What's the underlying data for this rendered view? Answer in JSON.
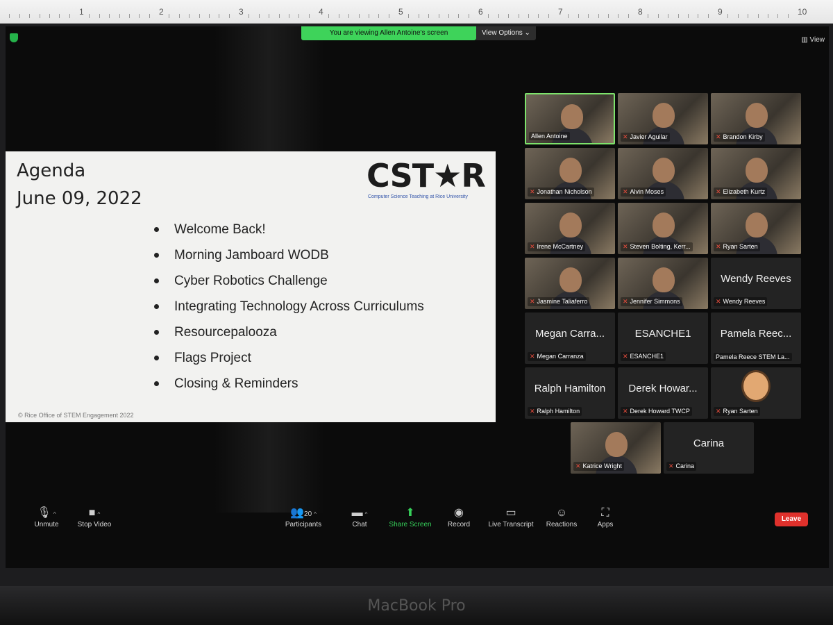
{
  "ruler": {
    "numbers": [
      "1",
      "2",
      "3",
      "4",
      "5",
      "6",
      "7",
      "8",
      "9",
      "10"
    ]
  },
  "zoom": {
    "banner": "You are viewing Allen Antoine's screen",
    "view_options": "View Options ⌄",
    "view_button": "View"
  },
  "slide": {
    "title": "Agenda",
    "date": "June 09, 2022",
    "logo": "CST★R",
    "logo_subtitle": "Computer Science Teaching at Rice University",
    "bullets": [
      "Welcome Back!",
      "Morning Jamboard WODB",
      "Cyber Robotics Challenge",
      "Integrating Technology Across Curriculums",
      "Resourcepalooza",
      "Flags Project",
      "Closing & Reminders"
    ],
    "copyright": "© Rice Office of STEM Engagement 2022"
  },
  "participants": [
    {
      "name": "Allen Antoine",
      "video": true,
      "active": true,
      "muted": false
    },
    {
      "name": "Javier Aguilar",
      "video": true,
      "muted": true
    },
    {
      "name": "Brandon Kirby",
      "video": true,
      "muted": true
    },
    {
      "name": "Jonathan Nicholson",
      "video": true,
      "muted": true
    },
    {
      "name": "Alvin Moses",
      "video": true,
      "muted": true
    },
    {
      "name": "Elizabeth Kurtz",
      "video": true,
      "muted": true
    },
    {
      "name": "Irene McCartney",
      "video": true,
      "muted": true
    },
    {
      "name": "Steven Bolting, Kerr...",
      "video": true,
      "muted": true
    },
    {
      "name": "Ryan Sarten",
      "video": true,
      "muted": true
    },
    {
      "name": "Jasmine Taliaferro",
      "video": true,
      "muted": true
    },
    {
      "name": "Jennifer Simmons",
      "video": true,
      "muted": true
    },
    {
      "name": "Wendy Reeves",
      "big": "Wendy Reeves",
      "video": false,
      "muted": true
    },
    {
      "name": "Megan Carranza",
      "big": "Megan Carra...",
      "video": false,
      "muted": true
    },
    {
      "name": "ESANCHE1",
      "big": "ESANCHE1",
      "video": false,
      "muted": true
    },
    {
      "name": "Pamela Reece STEM La...",
      "big": "Pamela Reec...",
      "video": false,
      "muted": false
    },
    {
      "name": "Ralph Hamilton",
      "big": "Ralph Hamilton",
      "video": false,
      "muted": true
    },
    {
      "name": "Derek Howard TWCP",
      "big": "Derek Howar...",
      "video": false,
      "muted": true
    },
    {
      "name": "Ryan Sarten",
      "video": false,
      "avatar": true,
      "muted": true
    },
    {
      "name": "Katrice Wright",
      "video": true,
      "muted": true
    },
    {
      "name": "Carina",
      "big": "Carina",
      "video": false,
      "muted": true
    }
  ],
  "toolbar": {
    "unmute": "Unmute",
    "stop_video": "Stop Video",
    "participants": "Participants",
    "participant_count": "20",
    "chat": "Chat",
    "share_screen": "Share Screen",
    "record": "Record",
    "live_transcript": "Live Transcript",
    "reactions": "Reactions",
    "apps": "Apps",
    "leave": "Leave"
  },
  "device": {
    "label": "MacBook Pro"
  },
  "colors": {
    "zoom_green": "#3ed35a",
    "leave_red": "#e0312c",
    "active_border": "#7de36b"
  }
}
